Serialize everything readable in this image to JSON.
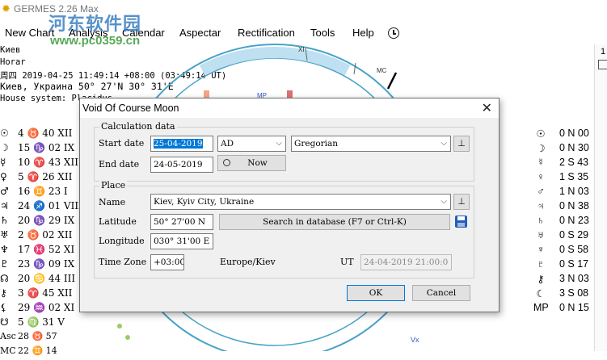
{
  "app": {
    "title": "GERMES 2.26 Max",
    "watermark_brand": "河东软件园",
    "watermark_url": "www.pc0359.cn"
  },
  "menu": [
    "New Chart",
    "Analysis",
    "Calendar",
    "Aspectar",
    "Rectification",
    "Tools",
    "Help"
  ],
  "info": {
    "line1": "Киев",
    "line2": "Horar",
    "line3": "周四 2019-04-25 11:49:14 +08:00 (03:49:14 UT)",
    "line4": "Киев, Украина 50° 27'N 30° 31'E",
    "line5": "House system: Placidus"
  },
  "planets_left": [
    {
      "glyph": "☉",
      "value": "4 ♉ 40 XII"
    },
    {
      "glyph": "☽",
      "value": "15 ♑ 02 IX"
    },
    {
      "glyph": "☿",
      "value": "10 ♈ 43 XII"
    },
    {
      "glyph": "♀",
      "value": "5 ♈ 26 XII"
    },
    {
      "glyph": "♂",
      "value": "16 ♊ 23 I"
    },
    {
      "glyph": "♃",
      "value": "24 ♐ 01 VIII"
    },
    {
      "glyph": "♄",
      "value": "20 ♑ 29 IX"
    },
    {
      "glyph": "♅",
      "value": "2 ♉ 02 XII"
    },
    {
      "glyph": "♆",
      "value": "17 ♓ 52 XI"
    },
    {
      "glyph": "♇",
      "value": "23 ♑ 09 IX"
    },
    {
      "glyph": "☊",
      "value": "20 ♋ 44 III"
    },
    {
      "glyph": "⚷",
      "value": "3 ♈ 45 XII"
    },
    {
      "glyph": "⚸",
      "value": "29 ♒ 02 XI"
    },
    {
      "glyph": "☋",
      "value": "5 ♍ 31 V"
    },
    {
      "glyph": "Asc",
      "value": "28 ♉ 57"
    },
    {
      "glyph": "MC",
      "value": "22 ♊ 14"
    }
  ],
  "planets_right": [
    {
      "glyph": "☉",
      "value": "0 N 00"
    },
    {
      "glyph": "☽",
      "value": "0 N 30"
    },
    {
      "glyph": "☿",
      "value": "2 S 43"
    },
    {
      "glyph": "♀",
      "value": "1 S 35"
    },
    {
      "glyph": "♂",
      "value": "1 N 03"
    },
    {
      "glyph": "♃",
      "value": "0 N 38"
    },
    {
      "glyph": "♄",
      "value": "0 N 23"
    },
    {
      "glyph": "♅",
      "value": "0 S 29"
    },
    {
      "glyph": "♆",
      "value": "0 S 58"
    },
    {
      "glyph": "♇",
      "value": "0 S 17"
    },
    {
      "glyph": "⚷",
      "value": "3 N 03"
    },
    {
      "glyph": "☾",
      "value": "3 S 08"
    },
    {
      "glyph": "MP",
      "value": "0 N 15"
    }
  ],
  "right_panel": {
    "value": "1"
  },
  "chart_labels": {
    "xi": "XI",
    "mc": "MC",
    "mp": "MP",
    "vx": "Vx"
  },
  "dialog": {
    "title": "Void Of Course Moon",
    "calc_group": "Calculation data",
    "start_date_label": "Start date",
    "start_date_value": "25-04-2019",
    "era_value": "AD",
    "calendar_value": "Gregorian",
    "end_date_label": "End date",
    "end_date_value": "24-05-2019",
    "now_label": "Now",
    "place_group": "Place",
    "name_label": "Name",
    "name_value": "Kiev, Kyiv City, Ukraine",
    "latitude_label": "Latitude",
    "latitude_value": "50° 27'00 N",
    "search_label": "Search in database (F7 or Ctrl-K)",
    "longitude_label": "Longitude",
    "longitude_value": "030° 31'00 E",
    "timezone_label": "Time Zone",
    "timezone_value": "+03:00",
    "timezone_name": "Europe/Kiev",
    "ut_label": "UT",
    "ut_value": "24-04-2019 21:00:0",
    "ok_label": "OK",
    "cancel_label": "Cancel"
  },
  "colors": {
    "accent": "#0078d7",
    "save_icon": "#1f5fb8",
    "wheel": "#4aa3c8",
    "watermark": "#3a7fc0"
  }
}
